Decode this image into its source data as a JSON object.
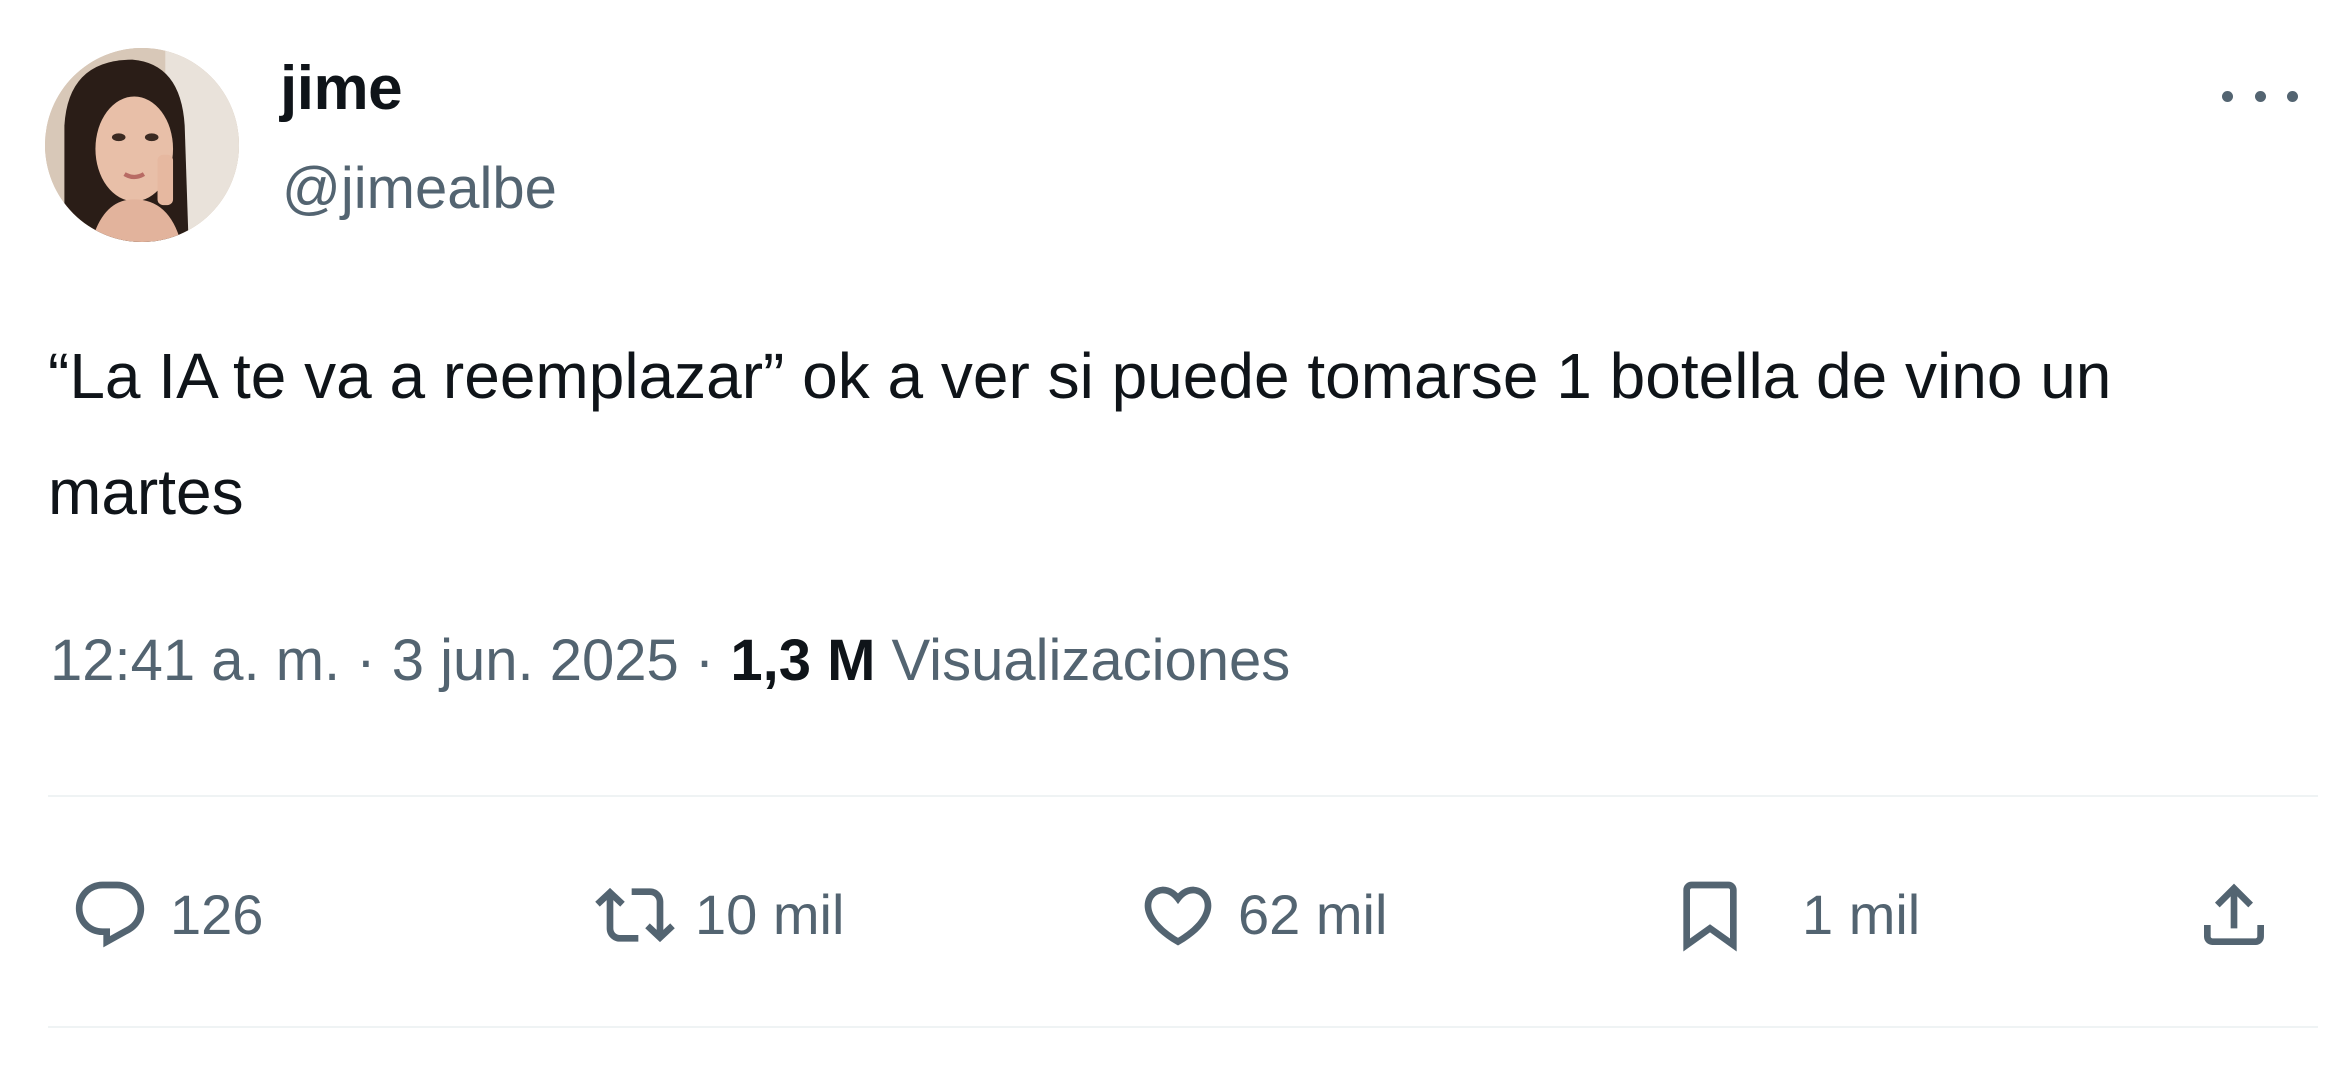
{
  "author": {
    "display_name": "jime",
    "handle": "@jimealbe"
  },
  "tweet": {
    "text": "“La IA te va a reemplazar” ok a ver si puede tomarse 1 botella de vino un martes"
  },
  "meta": {
    "time": "12:41 a. m.",
    "separator": "·",
    "date": "3 jun. 2025",
    "views_count": "1,3 M",
    "views_label": "Visualizaciones"
  },
  "actions": {
    "replies": "126",
    "reposts": "10 mil",
    "likes": "62 mil",
    "bookmarks": "1 mil"
  },
  "icons": {
    "more": "more-horizontal-icon",
    "reply": "reply-icon",
    "repost": "repost-icon",
    "like": "heart-icon",
    "bookmark": "bookmark-icon",
    "share": "share-icon"
  },
  "colors": {
    "text_primary": "#0f1419",
    "text_secondary": "#536471",
    "divider": "#eff3f4",
    "background": "#ffffff"
  }
}
